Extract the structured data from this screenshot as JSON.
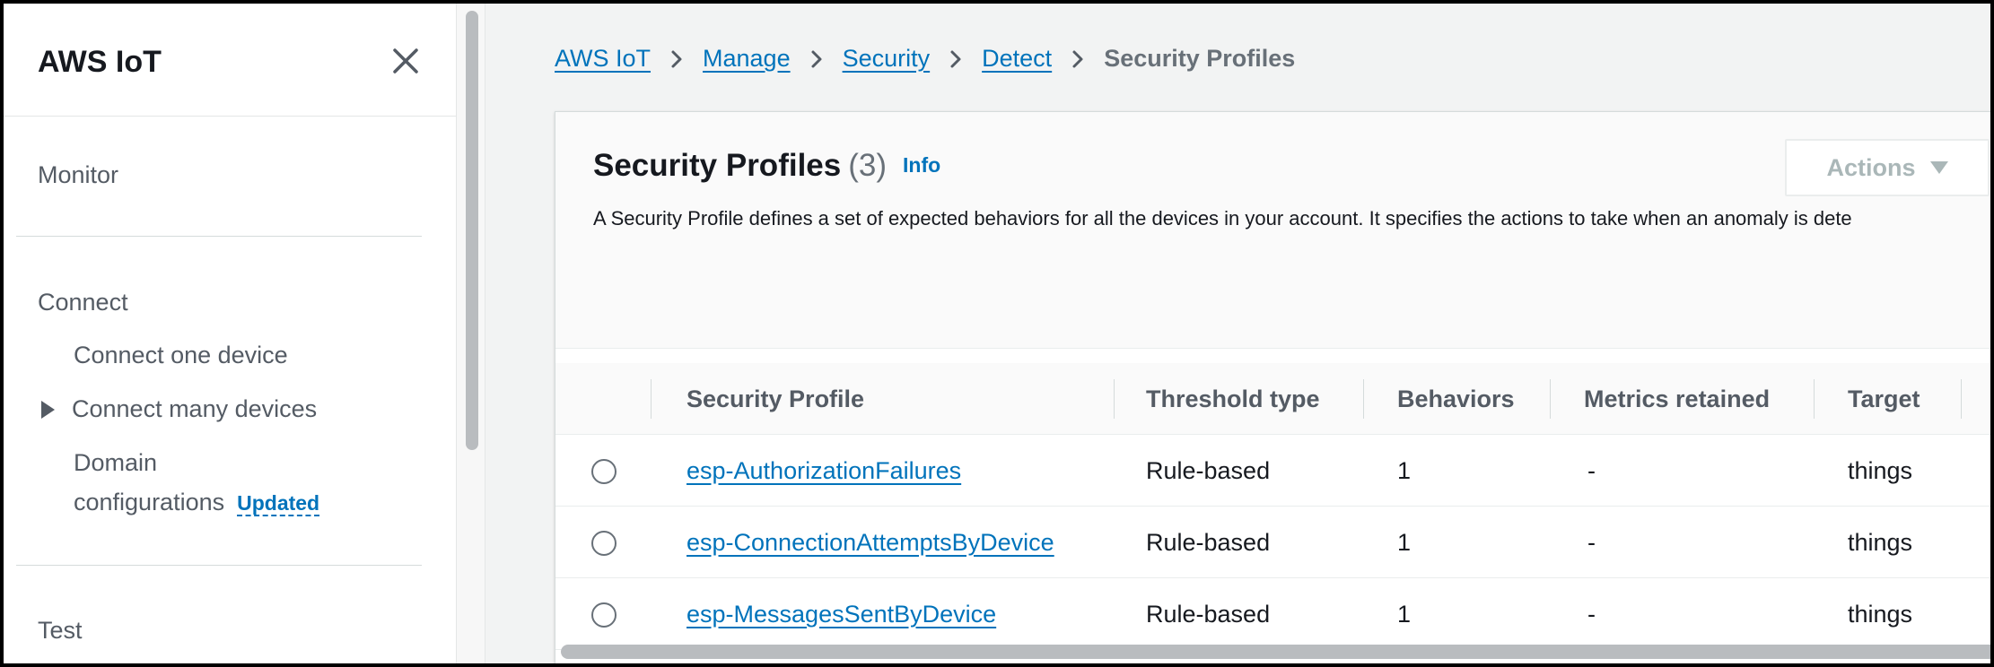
{
  "sidebar": {
    "title": "AWS IoT",
    "items": {
      "monitor": "Monitor",
      "connect": "Connect",
      "connect_one": "Connect one device",
      "connect_many": "Connect many devices",
      "domain_line1": "Domain",
      "domain_line2": "configurations",
      "domain_badge": "Updated",
      "test": "Test"
    }
  },
  "breadcrumbs": [
    "AWS IoT",
    "Manage",
    "Security",
    "Detect",
    "Security Profiles"
  ],
  "panel": {
    "title": "Security Profiles",
    "count": "(3)",
    "info": "Info",
    "description": "A Security Profile defines a set of expected behaviors for all the devices in your account. It specifies the actions to take when an anomaly is dete",
    "actions_label": "Actions"
  },
  "table": {
    "columns": [
      "Security Profile",
      "Threshold type",
      "Behaviors",
      "Metrics retained",
      "Target"
    ],
    "rows": [
      {
        "name": "esp-AuthorizationFailures",
        "threshold": "Rule-based",
        "behaviors": "1",
        "metrics": "-",
        "target": "things"
      },
      {
        "name": "esp-ConnectionAttemptsByDevice",
        "threshold": "Rule-based",
        "behaviors": "1",
        "metrics": "-",
        "target": "things"
      },
      {
        "name": "esp-MessagesSentByDevice",
        "threshold": "Rule-based",
        "behaviors": "1",
        "metrics": "-",
        "target": "things"
      }
    ]
  }
}
